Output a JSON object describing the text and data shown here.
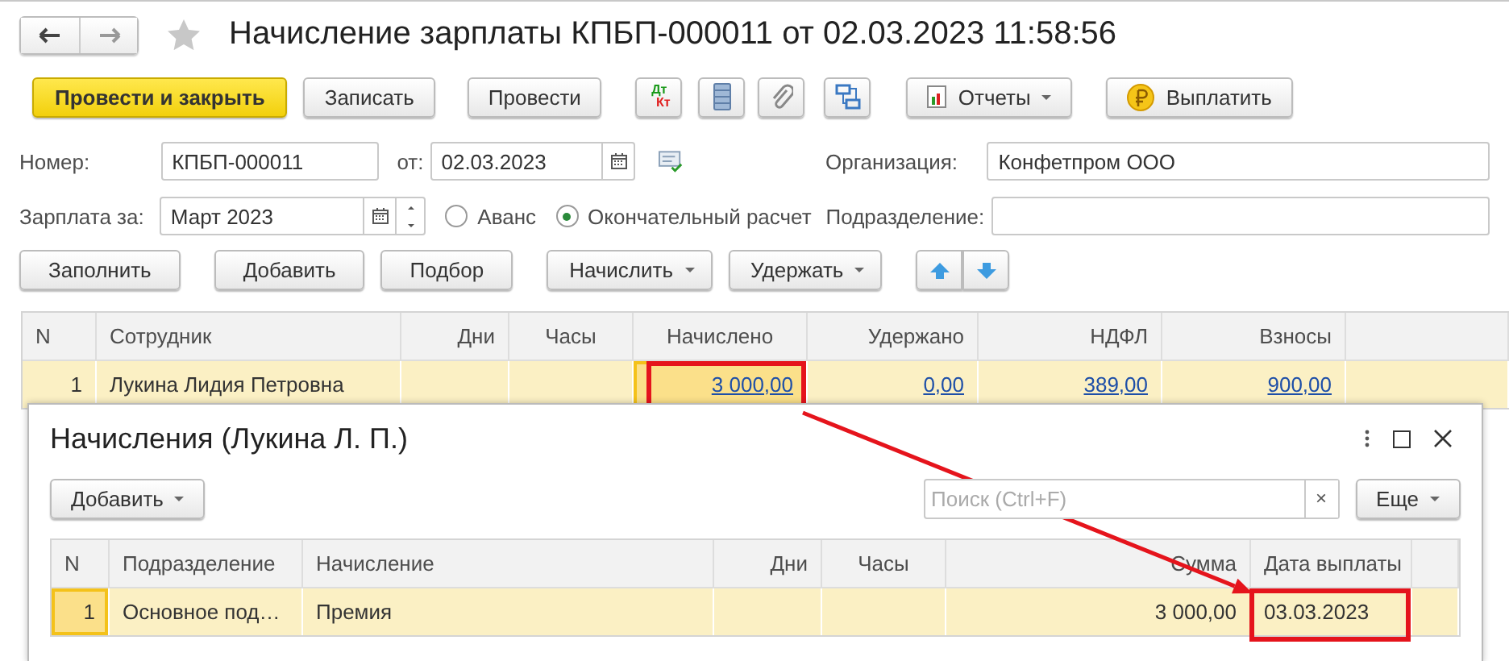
{
  "window": {
    "title": "Начисление зарплаты КПБП-000011 от 02.03.2023 11:58:56",
    "favorite": false
  },
  "toolbar": [
    {
      "kind": "primary",
      "label": "Провести и закрыть"
    },
    {
      "kind": "button",
      "label": "Записать"
    },
    {
      "kind": "button",
      "label": "Провести"
    },
    {
      "kind": "dtkt",
      "top": "Дт",
      "bottom": "Кт"
    },
    {
      "kind": "icon"
    },
    {
      "kind": "icon"
    },
    {
      "kind": "icon"
    },
    {
      "kind": "menu",
      "label": "Отчеты"
    },
    {
      "kind": "button",
      "label": "Выплатить"
    }
  ],
  "form": {
    "number": {
      "label": "Номер:",
      "value": "КПБП-000011"
    },
    "date": {
      "label": "от:",
      "value": "02.03.2023"
    },
    "organization": {
      "label": "Организация:",
      "value": "Конфетпром ООО"
    },
    "period": {
      "label": "Зарплата за:",
      "value": "Март 2023"
    },
    "payment_type": [
      {
        "label": "Аванс",
        "selected": false
      },
      {
        "label": "Окончательный расчет",
        "selected": true
      }
    ],
    "department": {
      "label": "Подразделение:"
    }
  },
  "table_toolbar": [
    {
      "label": "Заполнить",
      "dropdown": false
    },
    {
      "label": "Добавить",
      "dropdown": false
    },
    {
      "label": "Подбор",
      "dropdown": false
    },
    {
      "label": "Начислить",
      "dropdown": true
    },
    {
      "label": "Удержать",
      "dropdown": true
    }
  ],
  "table": {
    "columns": [
      "N",
      "Сотрудник",
      "Дни",
      "Часы",
      "Начислено",
      "Удержано",
      "НДФЛ",
      "Взносы"
    ],
    "rows": [
      {
        "n": "1",
        "employee": "Лукина Лидия Петровна",
        "accrued": "3 000,00",
        "withheld": "0,00",
        "ndfl": "389,00",
        "contributions": "900,00",
        "selected": true,
        "accrued_framed": true
      }
    ]
  },
  "dialog": {
    "title": "Начисления (Лукина Л. П.)",
    "add_button": {
      "label": "Добавить",
      "dropdown": true
    },
    "search": {
      "placeholder": "Поиск (Ctrl+F)"
    },
    "clear_button": {
      "label": "×"
    },
    "more_button": {
      "label": "Еще",
      "dropdown": true
    },
    "columns": [
      "N",
      "Подразделение",
      "Начисление",
      "Дни",
      "Часы",
      "Сумма",
      "Дата выплаты"
    ],
    "rows": [
      {
        "n": "1",
        "department": "Основное под…",
        "accrual": "Премия",
        "amount": "3 000,00",
        "pay_date": "03.03.2023",
        "selected": true,
        "pay_date_framed": true
      }
    ]
  }
}
